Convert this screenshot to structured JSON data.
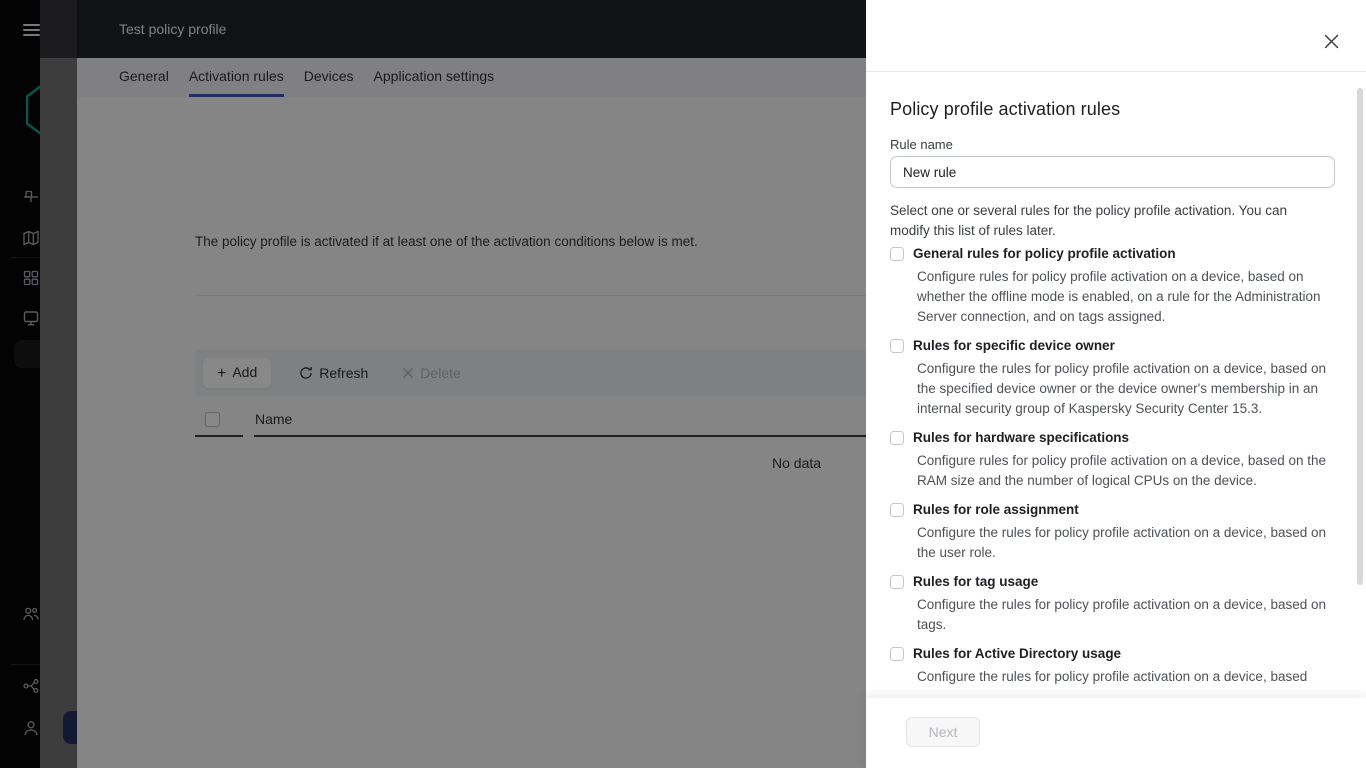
{
  "sidebar": {
    "icons": [
      "hamburger-menu",
      "kaspersky-logo",
      "server-node",
      "map",
      "apps-grid",
      "devices-monitor",
      "users",
      "pipeline",
      "account"
    ]
  },
  "modal": {
    "title": "Test policy profile",
    "tabs": [
      {
        "label": "General",
        "active": false
      },
      {
        "label": "Activation rules",
        "active": true
      },
      {
        "label": "Devices",
        "active": false
      },
      {
        "label": "Application settings",
        "active": false
      }
    ],
    "description": "The policy profile is activated if at least one of the activation conditions below is met.",
    "toolbar": {
      "add_label": "Add",
      "refresh_label": "Refresh",
      "delete_label": "Delete"
    },
    "table": {
      "name_column": "Name",
      "empty_text": "No data"
    }
  },
  "drawer": {
    "title": "Policy profile activation rules",
    "rule_name_label": "Rule name",
    "rule_name_value": "New rule",
    "intro": "Select one or several rules for the policy profile activation. You can modify this list of rules later.",
    "rules": [
      {
        "label": "General rules for policy profile activation",
        "checked": false,
        "description": "Configure rules for policy profile activation on a device, based on whether the offline mode is enabled, on a rule for the Administration Server connection, and on tags assigned."
      },
      {
        "label": "Rules for specific device owner",
        "checked": false,
        "description": "Configure the rules for policy profile activation on a device, based on the specified device owner or the device owner's membership in an internal security group of Kaspersky Security Center 15.3."
      },
      {
        "label": "Rules for hardware specifications",
        "checked": false,
        "description": "Configure rules for policy profile activation on a device, based on the RAM size and the number of logical CPUs on the device."
      },
      {
        "label": "Rules for role assignment",
        "checked": false,
        "description": "Configure the rules for policy profile activation on a device, based on the user role."
      },
      {
        "label": "Rules for tag usage",
        "checked": false,
        "description": "Configure the rules for policy profile activation on a device, based on tags."
      },
      {
        "label": "Rules for Active Directory usage",
        "checked": false,
        "description": "Configure the rules for policy profile activation on a device, based"
      }
    ],
    "next_label": "Next"
  },
  "colors": {
    "accent_blue": "#4156b9",
    "active_icon_blue": "#4b61c8",
    "logo_teal": "#00a88e",
    "dark_header": "#212226"
  }
}
